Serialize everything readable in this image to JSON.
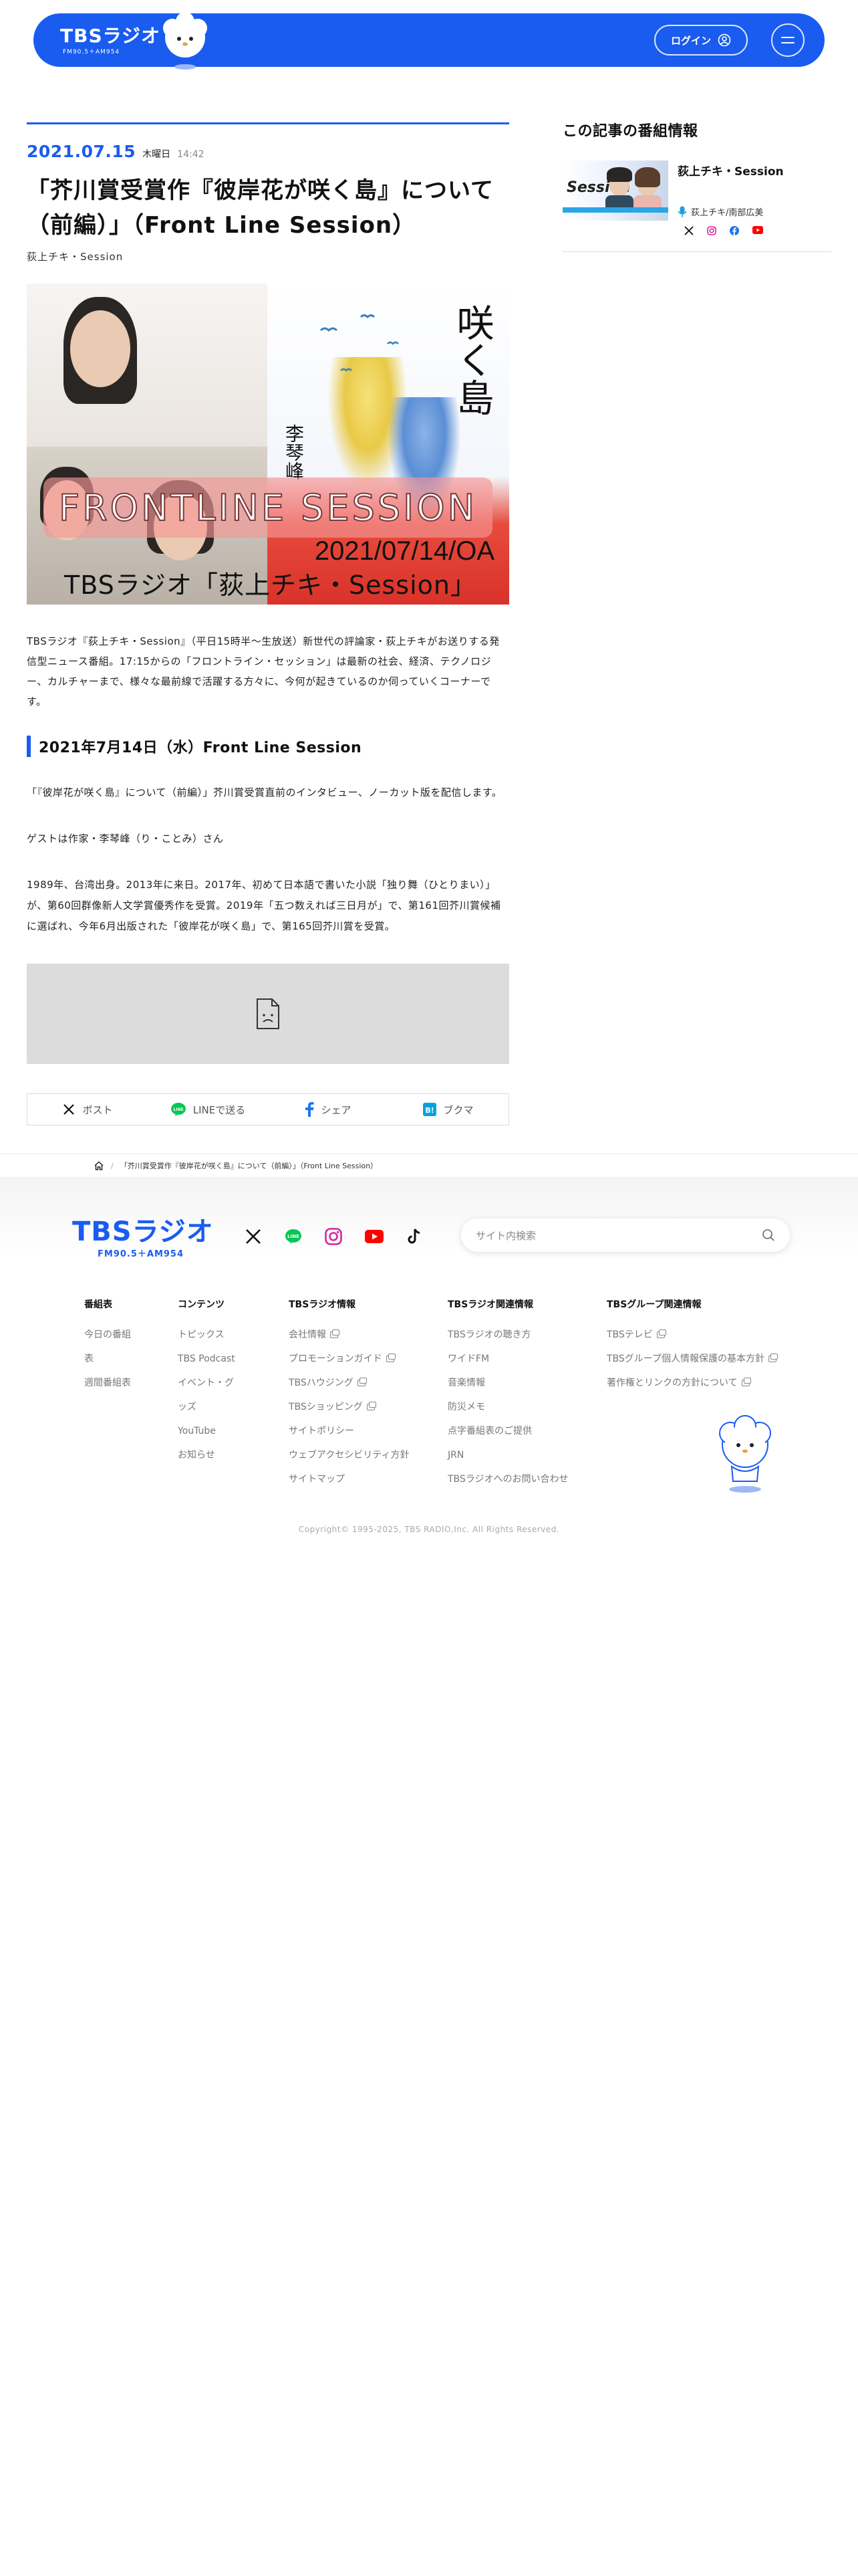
{
  "header": {
    "logo_main": "TBSラジオ",
    "logo_sub": "FM90.5＋AM954",
    "login_label": "ログイン"
  },
  "article": {
    "date": "2021.07.15",
    "weekday": "木曜日",
    "time": "14:42",
    "title": "「芥川賞受賞作『彼岸花が咲く島』について（前編）」（Front Line Session）",
    "program_name": "荻上チキ・Session",
    "hero": {
      "book_title": "咲く島",
      "book_author": "李琴峰",
      "band_text": "FRONTLINE SESSION",
      "date_text": "2021/07/14/OA",
      "caption": "TBSラジオ「荻上チキ・Session」"
    },
    "lead": "TBSラジオ『荻上チキ・Session』（平日15時半〜生放送）新世代の評論家・荻上チキがお送りする発信型ニュース番組。17:15からの「フロントライン・セッション」は最新の社会、経済、テクノロジー、カルチャーまで、様々な最前線で活躍する方々に、今何が起きているのか伺っていくコーナーです。",
    "sub_heading": "2021年7月14日（水）Front Line Session",
    "paragraphs": [
      "「『彼岸花が咲く島』について（前編）」芥川賞受賞直前のインタビュー、ノーカット版を配信します。",
      "ゲストは作家・李琴峰（り・ことみ）さん",
      "1989年、台湾出身。2013年に来日。2017年、初めて日本語で書いた小説「独り舞（ひとりまい）」が、第60回群像新人文学賞優秀作を受賞。2019年「五つ数えれば三日月が」で、第161回芥川賞候補に選ばれ、今年6月出版された「彼岸花が咲く島」で、第165回芥川賞を受賞。"
    ],
    "share": [
      {
        "label": "ポスト",
        "icon": "x-icon"
      },
      {
        "label": "LINEで送る",
        "icon": "line-icon"
      },
      {
        "label": "シェア",
        "icon": "facebook-icon"
      },
      {
        "label": "ブクマ",
        "icon": "hatena-bookmark-icon"
      }
    ]
  },
  "sidebar": {
    "heading": "この記事の番組情報",
    "program_title": "荻上チキ・Session",
    "thumb_text": "Session",
    "hosts": "荻上チキ/南部広美"
  },
  "breadcrumb": {
    "current": "「芥川賞受賞作『彼岸花が咲く島』について（前編）」（Front Line Session）"
  },
  "footer": {
    "logo_main": "TBSラジオ",
    "logo_sub": "FM90.5＋AM954",
    "search_placeholder": "サイト内検索",
    "columns": [
      {
        "heading": "番組表",
        "links": [
          {
            "label": "今日の番組表",
            "ext": false
          },
          {
            "label": "週間番組表",
            "ext": false
          }
        ]
      },
      {
        "heading": "コンテンツ",
        "links": [
          {
            "label": "トピックス",
            "ext": false
          },
          {
            "label": "TBS Podcast",
            "ext": false
          },
          {
            "label": "イベント・グッズ",
            "ext": false
          },
          {
            "label": "YouTube",
            "ext": false
          },
          {
            "label": "お知らせ",
            "ext": false
          }
        ]
      },
      {
        "heading": "TBSラジオ情報",
        "links": [
          {
            "label": "会社情報",
            "ext": true
          },
          {
            "label": "プロモーションガイド",
            "ext": true
          },
          {
            "label": "TBSハウジング",
            "ext": true
          },
          {
            "label": "TBSショッピング",
            "ext": true
          },
          {
            "label": "サイトポリシー",
            "ext": false
          },
          {
            "label": "ウェブアクセシビリティ方針",
            "ext": false
          },
          {
            "label": "サイトマップ",
            "ext": false
          }
        ]
      },
      {
        "heading": "TBSラジオ関連情報",
        "links": [
          {
            "label": "TBSラジオの聴き方",
            "ext": false
          },
          {
            "label": "ワイドFM",
            "ext": false
          },
          {
            "label": "音楽情報",
            "ext": false
          },
          {
            "label": "防災メモ",
            "ext": false
          },
          {
            "label": "点字番組表のご提供",
            "ext": false
          },
          {
            "label": "JRN",
            "ext": false
          },
          {
            "label": "TBSラジオへのお問い合わせ",
            "ext": false
          }
        ]
      },
      {
        "heading": "TBSグループ関連情報",
        "links": [
          {
            "label": "TBSテレビ",
            "ext": true
          },
          {
            "label": "TBSグループ個人情報保護の基本方針",
            "ext": true
          },
          {
            "label": "著作権とリンクの方針について",
            "ext": true
          }
        ]
      }
    ],
    "copyright": "Copyright© 1995-2025, TBS RADIO,Inc. All Rights Reserved."
  },
  "colors": {
    "brand": "#1a5cf0",
    "line": "#06c755",
    "hatena": "#00a4de",
    "facebook": "#1877f2",
    "youtube": "#ff0000"
  }
}
